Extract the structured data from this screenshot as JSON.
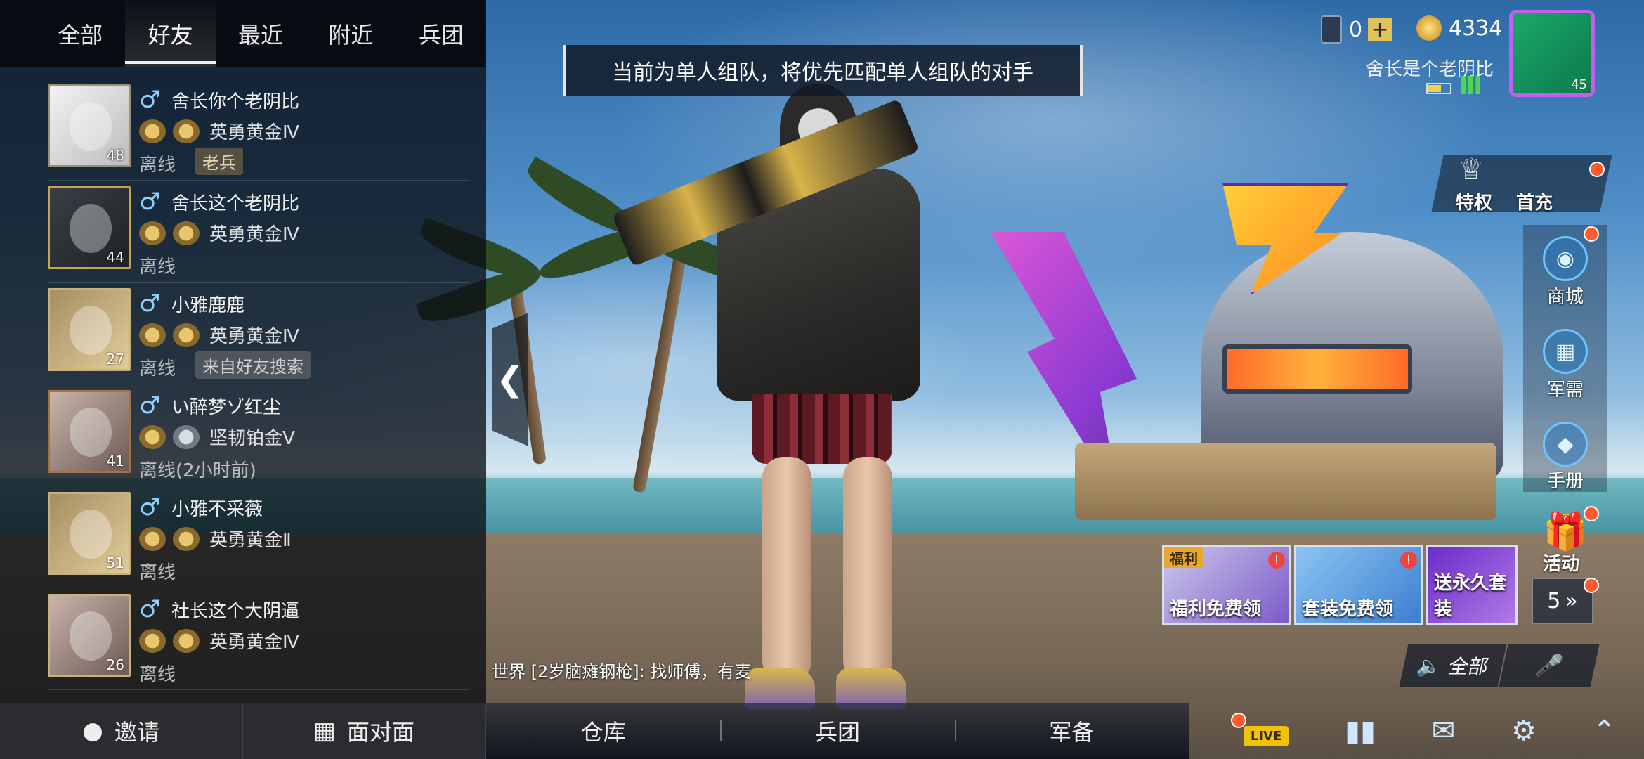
{
  "friends_panel": {
    "tabs": [
      "全部",
      "好友",
      "最近",
      "附近",
      "兵团"
    ],
    "active_tab_index": 1,
    "friends": [
      {
        "name": "舍长你个老阴比",
        "gender": "♂",
        "rank": "英勇黄金Ⅳ",
        "status": "离线",
        "tag": "老兵",
        "level": "48"
      },
      {
        "name": "舍长这个老阴比",
        "gender": "♂",
        "rank": "英勇黄金Ⅳ",
        "status": "离线",
        "tag": "",
        "level": "44"
      },
      {
        "name": "小雅鹿鹿",
        "gender": "♂",
        "rank": "英勇黄金Ⅳ",
        "status": "离线",
        "tag": "来自好友搜索",
        "level": "27"
      },
      {
        "name": "い醉梦ゾ红尘",
        "gender": "♂",
        "rank": "坚韧铂金Ⅴ",
        "status": "离线(2小时前)",
        "tag": "",
        "level": "41"
      },
      {
        "name": "小雅不采薇",
        "gender": "♂",
        "rank": "英勇黄金Ⅱ",
        "status": "离线",
        "tag": "",
        "level": "51"
      },
      {
        "name": "社长这个大阴逼",
        "gender": "♂",
        "rank": "英勇黄金Ⅳ",
        "status": "离线",
        "tag": "",
        "level": "26"
      }
    ],
    "invite_label": "邀请",
    "face_to_face_label": "面对面"
  },
  "notice": "当前为单人组队，将优先匹配单人组队的对手",
  "currency": {
    "uc": "0",
    "coins": "4334"
  },
  "player": {
    "name": "舍长是个老阴比",
    "level": "45"
  },
  "right_menu": {
    "vip": "特权",
    "first_charge": "首充",
    "shop": "商城",
    "supply": "军需",
    "handbook": "手册",
    "activity": "活动"
  },
  "events": [
    {
      "label": "福利免费领",
      "badge": "福利"
    },
    {
      "label": "套装免费领",
      "badge": ""
    },
    {
      "label": "送永久套装",
      "badge": ""
    }
  ],
  "events_more": "5",
  "chat": {
    "voice_all": "全部",
    "line": "世界  [2岁脑瘫钢枪]: 找师傅，有麦"
  },
  "bottom_nav": [
    "仓库",
    "兵团",
    "军备"
  ],
  "bottom_icons": {
    "live": "LIVE"
  }
}
